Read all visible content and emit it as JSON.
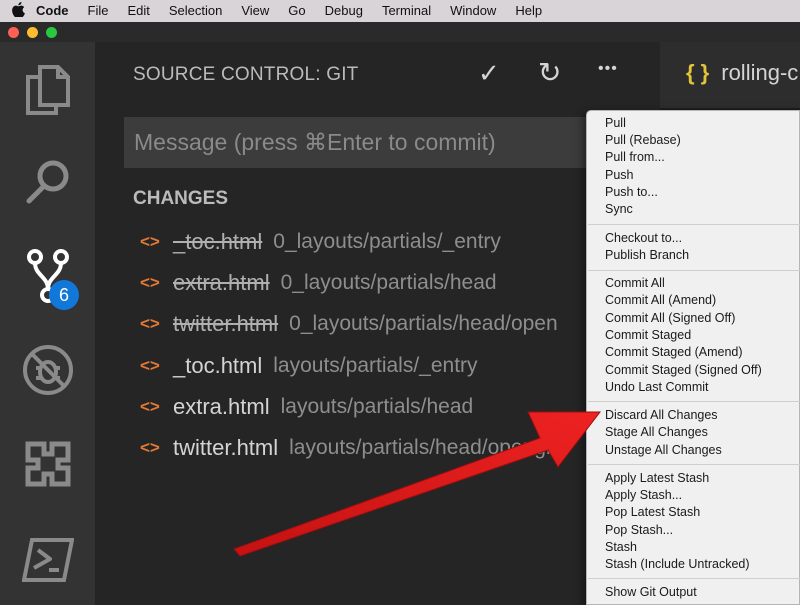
{
  "menubar": {
    "items": [
      "Code",
      "File",
      "Edit",
      "Selection",
      "View",
      "Go",
      "Debug",
      "Terminal",
      "Window",
      "Help"
    ]
  },
  "colors": {
    "traffic_close": "#fe5f57",
    "traffic_min": "#febc2e",
    "traffic_max": "#28c840",
    "badge": "#1177d8",
    "file_icon": "#e37933",
    "arrow": "#e01e1e"
  },
  "activity_bar": {
    "icons": [
      "explorer-icon",
      "search-icon",
      "source-control-icon",
      "debug-icon",
      "extensions-icon",
      "powershell-icon"
    ],
    "scm_badge": "6"
  },
  "sidebar": {
    "title": "SOURCE CONTROL: GIT",
    "tools": {
      "commit": "✓",
      "refresh": "↻",
      "more": "•••"
    },
    "message_placeholder": "Message (press ⌘Enter to commit)",
    "changes_header": "CHANGES",
    "files": [
      {
        "name": "_toc.html",
        "path": "0_layouts/partials/_entry",
        "deleted": true
      },
      {
        "name": "extra.html",
        "path": "0_layouts/partials/head",
        "deleted": true
      },
      {
        "name": "twitter.html",
        "path": "0_layouts/partials/head/open",
        "deleted": true
      },
      {
        "name": "_toc.html",
        "path": "layouts/partials/_entry",
        "deleted": false
      },
      {
        "name": "extra.html",
        "path": "layouts/partials/head",
        "deleted": false
      },
      {
        "name": "twitter.html",
        "path": "layouts/partials/head/opengra",
        "deleted": false
      }
    ],
    "file_icon_glyph": "<>"
  },
  "editor": {
    "tab_icon": "{ }",
    "tab_label": "rolling-c"
  },
  "context_menu": {
    "groups": [
      [
        "Pull",
        "Pull (Rebase)",
        "Pull from...",
        "Push",
        "Push to...",
        "Sync"
      ],
      [
        "Checkout to...",
        "Publish Branch"
      ],
      [
        "Commit All",
        "Commit All (Amend)",
        "Commit All (Signed Off)",
        "Commit Staged",
        "Commit Staged (Amend)",
        "Commit Staged (Signed Off)",
        "Undo Last Commit"
      ],
      [
        "Discard All Changes",
        "Stage All Changes",
        "Unstage All Changes"
      ],
      [
        "Apply Latest Stash",
        "Apply Stash...",
        "Pop Latest Stash",
        "Pop Stash...",
        "Stash",
        "Stash (Include Untracked)"
      ],
      [
        "Show Git Output"
      ]
    ]
  }
}
